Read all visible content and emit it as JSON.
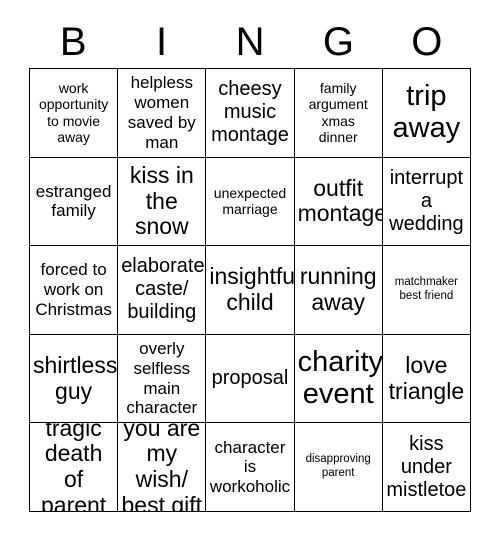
{
  "card": {
    "title_letters": [
      "B",
      "I",
      "N",
      "G",
      "O"
    ],
    "grid_rows": [
      [
        {
          "text": "work\nopportunity\nto movie\naway",
          "size": "sm"
        },
        {
          "text": "helpless\nwomen\nsaved by\nman",
          "size": "md"
        },
        {
          "text": "cheesy\nmusic\nmontage",
          "size": "lg"
        },
        {
          "text": "family\nargument\nxmas\ndinner",
          "size": "sm"
        },
        {
          "text": "trip\naway",
          "size": "xxl"
        }
      ],
      [
        {
          "text": "estranged\nfamily",
          "size": "md"
        },
        {
          "text": "kiss in\nthe\nsnow",
          "size": "xl"
        },
        {
          "text": "unexpected\nmarriage",
          "size": "sm"
        },
        {
          "text": "outfit\nmontage",
          "size": "xl"
        },
        {
          "text": "interrupt\na\nwedding",
          "size": "lg"
        }
      ],
      [
        {
          "text": "forced to\nwork on\nChristmas",
          "size": "md"
        },
        {
          "text": "elaborate\ncaste/\nbuilding",
          "size": "lg"
        },
        {
          "text": "insightful\nchild",
          "size": "xl"
        },
        {
          "text": "running\naway",
          "size": "xl"
        },
        {
          "text": "matchmaker\nbest friend",
          "size": "xs"
        }
      ],
      [
        {
          "text": "shirtless\nguy",
          "size": "xl"
        },
        {
          "text": "overly\nselfless\nmain\ncharacter",
          "size": "md"
        },
        {
          "text": "proposal",
          "size": "lg"
        },
        {
          "text": "charity\nevent",
          "size": "xxl"
        },
        {
          "text": "love\ntriangle",
          "size": "xl"
        }
      ],
      [
        {
          "text": "tragic\ndeath of\nparent",
          "size": "xl"
        },
        {
          "text": "you are\nmy wish/\nbest gift",
          "size": "xl"
        },
        {
          "text": "character\nis\nworkoholic",
          "size": "md"
        },
        {
          "text": "disapproving\nparent",
          "size": "xs"
        },
        {
          "text": "kiss\nunder\nmistletoe",
          "size": "lg"
        }
      ]
    ],
    "colors": {
      "background": "#ffffff",
      "text": "#000000",
      "border": "#000000"
    }
  }
}
